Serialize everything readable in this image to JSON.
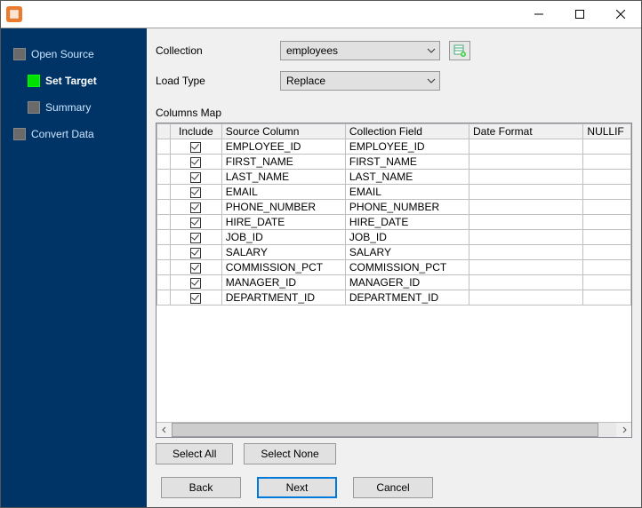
{
  "nav": {
    "open_source": "Open Source",
    "set_target": "Set Target",
    "summary": "Summary",
    "convert_data": "Convert Data"
  },
  "form": {
    "collection_label": "Collection",
    "collection_value": "employees",
    "load_type_label": "Load Type",
    "load_type_value": "Replace"
  },
  "columns_map_label": "Columns Map",
  "headers": {
    "include": "Include",
    "source": "Source Column",
    "field": "Collection Field",
    "date": "Date Format",
    "nullif": "NULLIF"
  },
  "rows": [
    {
      "source": "EMPLOYEE_ID",
      "field": "EMPLOYEE_ID"
    },
    {
      "source": "FIRST_NAME",
      "field": "FIRST_NAME"
    },
    {
      "source": "LAST_NAME",
      "field": "LAST_NAME"
    },
    {
      "source": "EMAIL",
      "field": "EMAIL"
    },
    {
      "source": "PHONE_NUMBER",
      "field": "PHONE_NUMBER"
    },
    {
      "source": "HIRE_DATE",
      "field": "HIRE_DATE"
    },
    {
      "source": "JOB_ID",
      "field": "JOB_ID"
    },
    {
      "source": "SALARY",
      "field": "SALARY"
    },
    {
      "source": "COMMISSION_PCT",
      "field": "COMMISSION_PCT"
    },
    {
      "source": "MANAGER_ID",
      "field": "MANAGER_ID"
    },
    {
      "source": "DEPARTMENT_ID",
      "field": "DEPARTMENT_ID"
    }
  ],
  "buttons": {
    "select_all": "Select All",
    "select_none": "Select None",
    "back": "Back",
    "next": "Next",
    "cancel": "Cancel"
  }
}
